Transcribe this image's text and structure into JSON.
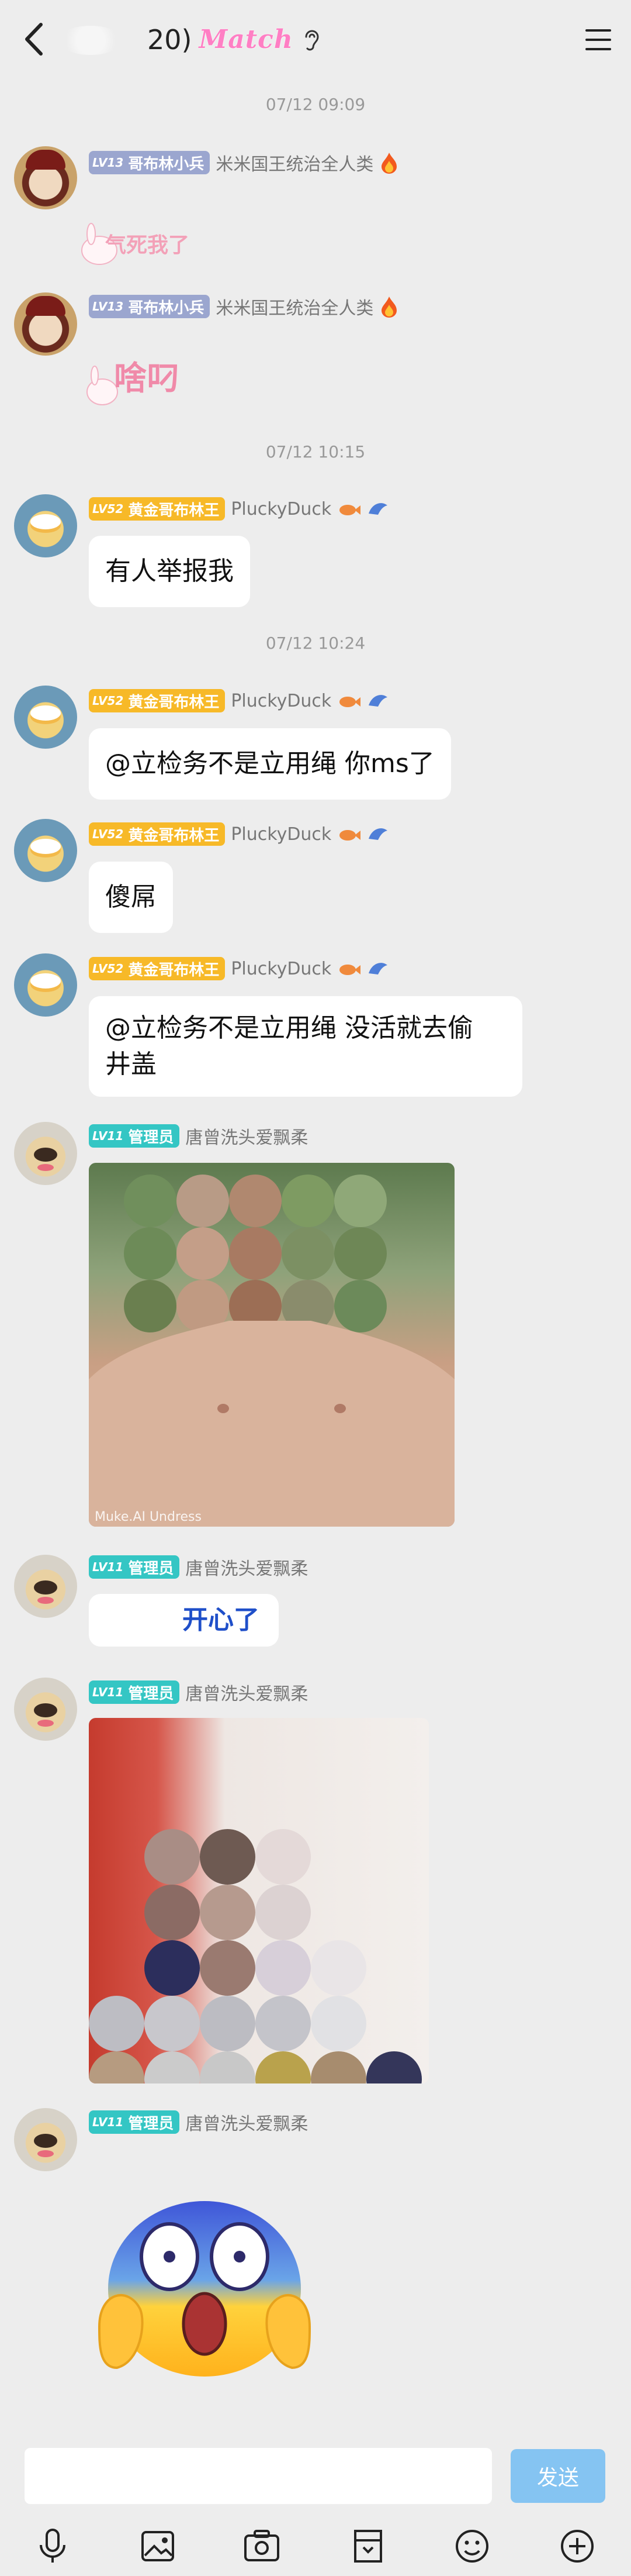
{
  "header": {
    "title_suffix": "20)",
    "brand": "Match"
  },
  "messages": [
    {
      "type": "time",
      "text": "07/12 09:09"
    },
    {
      "sender": {
        "level": "LV13",
        "title": "哥布林小兵",
        "nick": "米米国王统治全人类"
      },
      "sticker": "气死我了"
    },
    {
      "sender": {
        "level": "LV13",
        "title": "哥布林小兵",
        "nick": "米米国王统治全人类"
      },
      "sticker": "啥叼"
    },
    {
      "type": "time",
      "text": "07/12 10:15"
    },
    {
      "sender": {
        "level": "LV52",
        "title": "黄金哥布林王",
        "nick": "PluckyDuck"
      },
      "text": "有人举报我"
    },
    {
      "type": "time",
      "text": "07/12 10:24"
    },
    {
      "sender": {
        "level": "LV52",
        "title": "黄金哥布林王",
        "nick": "PluckyDuck"
      },
      "text": "@立检务不是立用绳 你ms了"
    },
    {
      "sender": {
        "level": "LV52",
        "title": "黄金哥布林王",
        "nick": "PluckyDuck"
      },
      "text": "傻屌"
    },
    {
      "sender": {
        "level": "LV52",
        "title": "黄金哥布林王",
        "nick": "PluckyDuck"
      },
      "text_line1": "@立检务不是立用绳 没活就去偷",
      "text_line2": "井盖"
    },
    {
      "sender": {
        "level": "LV11",
        "title": "管理员",
        "nick": "唐曾洗头爱飘柔"
      },
      "image_caption": "Muke.AI Undress"
    },
    {
      "sender": {
        "level": "LV11",
        "title": "管理员",
        "nick": "唐曾洗头爱飘柔"
      },
      "text": "开心了"
    },
    {
      "sender": {
        "level": "LV11",
        "title": "管理员",
        "nick": "唐曾洗头爱飘柔"
      }
    },
    {
      "sender": {
        "level": "LV11",
        "title": "管理员",
        "nick": "唐曾洗头爱飘柔"
      }
    }
  ],
  "composer": {
    "placeholder": "",
    "send_label": "发送"
  },
  "icons": {
    "back": "chevron-left-icon",
    "menu": "hamburger-menu-icon",
    "mic": "microphone-icon",
    "image": "image-icon",
    "camera": "camera-icon",
    "file": "file-icon",
    "emoji": "emoji-icon",
    "plus": "plus-icon"
  },
  "colors": {
    "background": "#ededed",
    "send_button": "#85c4f2",
    "badge_lv13": "#9ba6cf",
    "badge_lv52": "#f7b928",
    "badge_lv11": "#34c6c4",
    "brand": "#ff7fc4"
  }
}
